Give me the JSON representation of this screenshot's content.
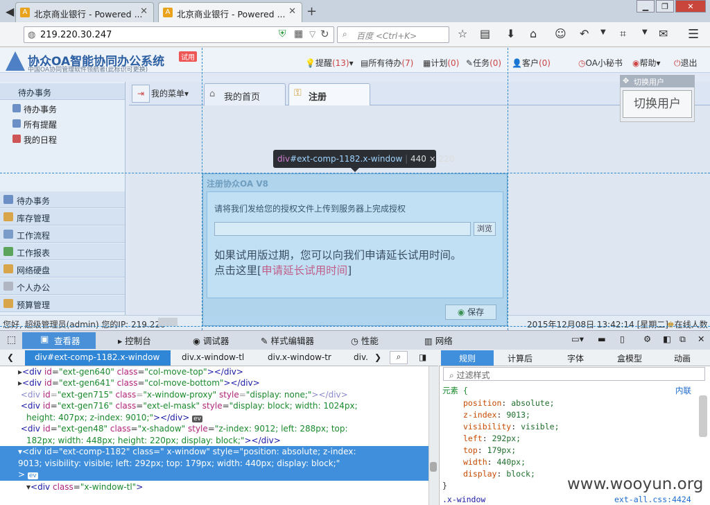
{
  "browser": {
    "tabs": [
      {
        "label": "北京商业银行 - Powered ..."
      },
      {
        "label": "北京商业银行 - Powered ..."
      }
    ],
    "url": "219.220.30.247",
    "search_placeholder": "百度 <Ctrl+K>"
  },
  "app": {
    "title": "协众OA智能协同办公系统",
    "subtitle": "中国OA协同管理软件领航者(此标识可更换)",
    "trial_badge": "试用",
    "toplinks": [
      {
        "label": "提醒",
        "count": "(13)"
      },
      {
        "label": "所有待办",
        "count": "(7)"
      },
      {
        "label": "计划",
        "count": "(0)"
      },
      {
        "label": "任务",
        "count": "(0)"
      },
      {
        "label": "客户",
        "count": "(0)"
      },
      {
        "label": "OA小秘书",
        "count": ""
      },
      {
        "label": "帮助",
        "count": ""
      },
      {
        "label": "退出",
        "count": ""
      }
    ],
    "sidebar": {
      "header": "待办事务",
      "items": [
        "待办事务",
        "所有提醒",
        "我的日程"
      ],
      "nav": [
        "待办事务",
        "库存管理",
        "工作流程",
        "工作报表",
        "网络硬盘",
        "个人办公",
        "预算管理"
      ]
    },
    "tabs": {
      "menu": "我的菜单",
      "home": "我的首页",
      "register": "注册"
    },
    "switch_user": {
      "header": "切换用户",
      "button": "切换用户"
    },
    "status": {
      "left": "您好, 超级管理员(admin) 您的IP: 219.220",
      "right": "2015年12月08日 13:42:14 [星期二]",
      "online": "在线人数"
    },
    "dialog": {
      "title": "注册协众OA V8",
      "prompt": "请将我们发给您的授权文件上传到服务器上完成授权",
      "browse": "浏览",
      "msg1": "如果试用版过期，您可以向我们申请延长试用时间。",
      "msg2_prefix": "点击这里[",
      "msg2_link": "申请延长试用时间",
      "msg2_suffix": "]",
      "save": "保存"
    },
    "tooltip": {
      "tag": "div",
      "id": "#ext-comp-1182.x-window",
      "size": "440 × 220"
    }
  },
  "devtools": {
    "tabs": [
      "查看器",
      "控制台",
      "调试器",
      "样式编辑器",
      "性能",
      "网络"
    ],
    "crumbs": [
      "div#ext-comp-1182.x-window",
      "div.x-window-tl",
      "div.x-window-tr",
      "div."
    ],
    "side_tabs": [
      "规则",
      "计算后",
      "字体",
      "盒模型",
      "动画"
    ],
    "filter_placeholder": "过滤样式",
    "element_label": "元素 {",
    "inline_label": "内联",
    "rules": [
      {
        "prop": "position",
        "val": "absolute;"
      },
      {
        "prop": "z-index",
        "val": "9013;"
      },
      {
        "prop": "visibility",
        "val": "visible;"
      },
      {
        "prop": "left",
        "val": "292px;"
      },
      {
        "prop": "top",
        "val": "179px;"
      },
      {
        "prop": "width",
        "val": "440px;"
      },
      {
        "prop": "display",
        "val": "block;"
      }
    ],
    "close_brace": "}",
    "next_rule": ".x-window",
    "next_src": "ext-all.css:4424"
  },
  "watermark": "www.wooyun.org"
}
